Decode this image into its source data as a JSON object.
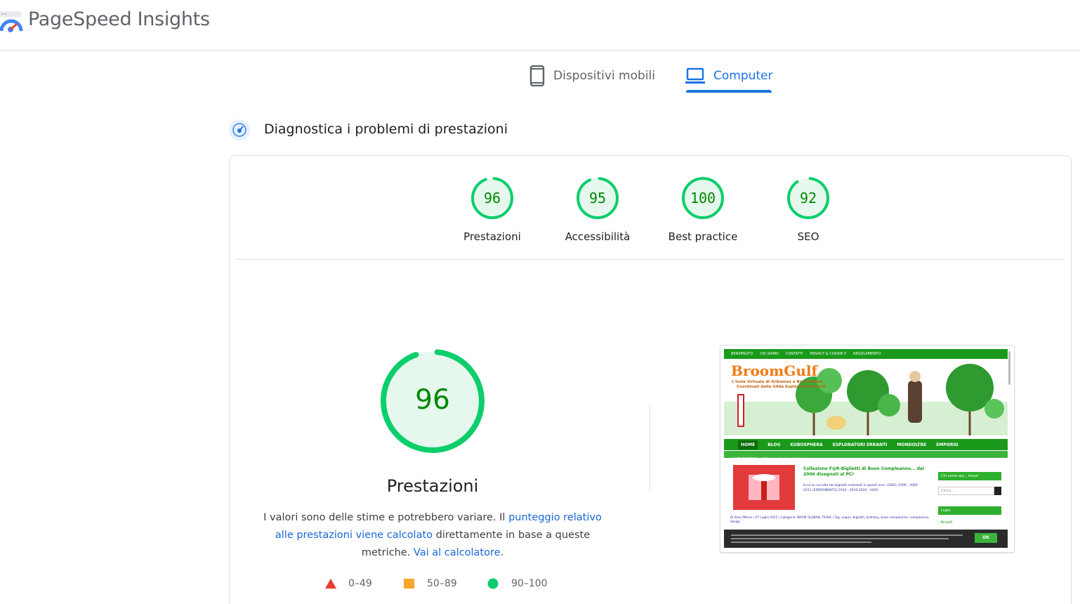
{
  "header": {
    "brand": "PageSpeed Insights"
  },
  "tabs": [
    {
      "label": "Dispositivi mobili",
      "icon": "smartphone-icon",
      "active": false
    },
    {
      "label": "Computer",
      "icon": "laptop-icon",
      "active": true
    }
  ],
  "section": {
    "title": "Diagnostica i problemi di prestazioni",
    "icon": "diagnostics-icon"
  },
  "scores": [
    {
      "value": "96",
      "label": "Prestazioni",
      "fraction": 0.96
    },
    {
      "value": "95",
      "label": "Accessibilità",
      "fraction": 0.95
    },
    {
      "value": "100",
      "label": "Best practice",
      "fraction": 1.0
    },
    {
      "value": "92",
      "label": "SEO",
      "fraction": 0.92
    }
  ],
  "performance": {
    "score": "96",
    "fraction": 0.96,
    "title": "Prestazioni",
    "desc_text1": "I valori sono delle stime e potrebbero variare. Il ",
    "desc_link1": "punteggio relativo alle prestazioni viene calcolato",
    "desc_text2": " direttamente in base a queste metriche. ",
    "desc_link2": "Vai al calcolatore."
  },
  "legend": [
    {
      "range": "0–49",
      "shape": "triangle",
      "color": "#eb3b2f"
    },
    {
      "range": "50–89",
      "shape": "square",
      "color": "#f9a62b"
    },
    {
      "range": "90–100",
      "shape": "circle",
      "color": "#0cce6b"
    }
  ],
  "colors": {
    "pass": "#0cce6b",
    "pass_text": "#008800",
    "pass_fill": "#e6f8ee",
    "accent": "#1a73e8"
  },
  "screenshot": {
    "top_links": [
      "BENVENUTO",
      "CHI SIAMO",
      "CONTATTI",
      "PRIVACY & COOKIE P",
      "REGOLAMENTO"
    ],
    "brand": "BroomGulf",
    "tagline1": "L'Isola Virtuale di Arikamez e Broo Mllenn",
    "tagline2": "Coordinati dalla Gilda Esploratori Erranti",
    "nav": [
      "HOME",
      "BLOG",
      "KUBOSPHERA",
      "ESPLORATORI ERRANTI",
      "MONDOLTRE",
      "EMPORIO"
    ],
    "last_posted": "LAST POSTED – Ultimi articoli pubblicati",
    "post_title": "Collezione F@R-Biglietti di Buon Compleanno... dal 2006 disegnati al PC!",
    "post_body": "Ecco la raccolta dei biglietti realizzati in questi anni: (2001) 2006 - 2009 2011 (ESPERIMENTO) 2010 - 2019 2020 - 2029",
    "post_meta": "Di Broo Mllenn | 07 Luglio 2025 | Categorie: BROM GLOBAN, TEAVE | Tag: augun, biglietti, birthday, buon compleanno, compleanno, design",
    "sidebar_head": "Chi cerca qui... trova!",
    "search_placeholder": "Cerca...",
    "login": "Login",
    "accedi": "› Accedi",
    "ok_button": "OK"
  }
}
